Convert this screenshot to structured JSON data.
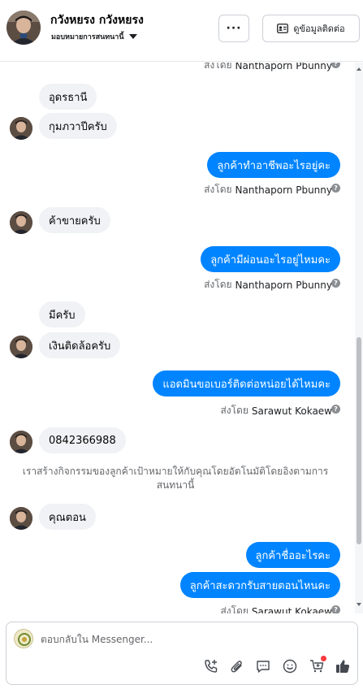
{
  "header": {
    "contact_name": "กวังหยรง กวังหยรง",
    "status_label": "มอบหมายการสนทนานี้",
    "more_label": "···",
    "contact_info_label": "ดูข้อมูลติดต่อ"
  },
  "messages": [
    {
      "type": "sent_by",
      "label": "ส่งโดย",
      "name": "Nanthaporn Pbunny"
    },
    {
      "type": "in",
      "text": "อุดรธานี"
    },
    {
      "type": "in",
      "text": "กุมภวาปีครับ"
    },
    {
      "type": "out",
      "text": "ลูกค้าทำอาชีพอะไรอยู่คะ"
    },
    {
      "type": "sent_by",
      "label": "ส่งโดย",
      "name": "Nanthaporn Pbunny"
    },
    {
      "type": "in",
      "text": "ค้าขายครับ"
    },
    {
      "type": "out",
      "text": "ลูกค้ามีผ่อนอะไรอยู่ไหมคะ"
    },
    {
      "type": "sent_by",
      "label": "ส่งโดย",
      "name": "Nanthaporn Pbunny"
    },
    {
      "type": "in",
      "text": "มีครับ"
    },
    {
      "type": "in",
      "text": "เงินติดล้อครับ"
    },
    {
      "type": "out",
      "text": "แอดมินขอเบอร์ติดต่อหน่อยได้ไหมคะ"
    },
    {
      "type": "sent_by",
      "label": "ส่งโดย",
      "name": "Sarawut Kokaew"
    },
    {
      "type": "in",
      "text": "0842366988"
    },
    {
      "type": "notice",
      "text": "เราสร้างกิจกรรมของลูกค้าเป้าหมายให้กับคุณโดยอัตโนมัติโดยอิงตามการสนทนานี้"
    },
    {
      "type": "in",
      "text": "คุณตอน"
    },
    {
      "type": "out",
      "text": "ลูกค้าชื่ออะไรคะ"
    },
    {
      "type": "out",
      "text": "ลูกค้าสะดวกรับสายตอนไหนคะ"
    },
    {
      "type": "sent_by",
      "label": "ส่งโดย",
      "name": "Sarawut Kokaew"
    }
  ],
  "composer": {
    "placeholder": "ตอบกลับใน Messenger..."
  },
  "icons": {
    "more": "more-dots-icon",
    "contact_info": "contact-card-icon",
    "help": "question-icon",
    "tools": [
      "add-call-icon",
      "attachment-icon",
      "saved-replies-icon",
      "emoji-icon",
      "add-to-cart-icon",
      "like-icon"
    ]
  },
  "colors": {
    "outgoing_bubble": "#0084ff",
    "incoming_bubble": "#f0f2f5",
    "secondary_text": "#65676b",
    "notification_dot": "#fa383e"
  }
}
